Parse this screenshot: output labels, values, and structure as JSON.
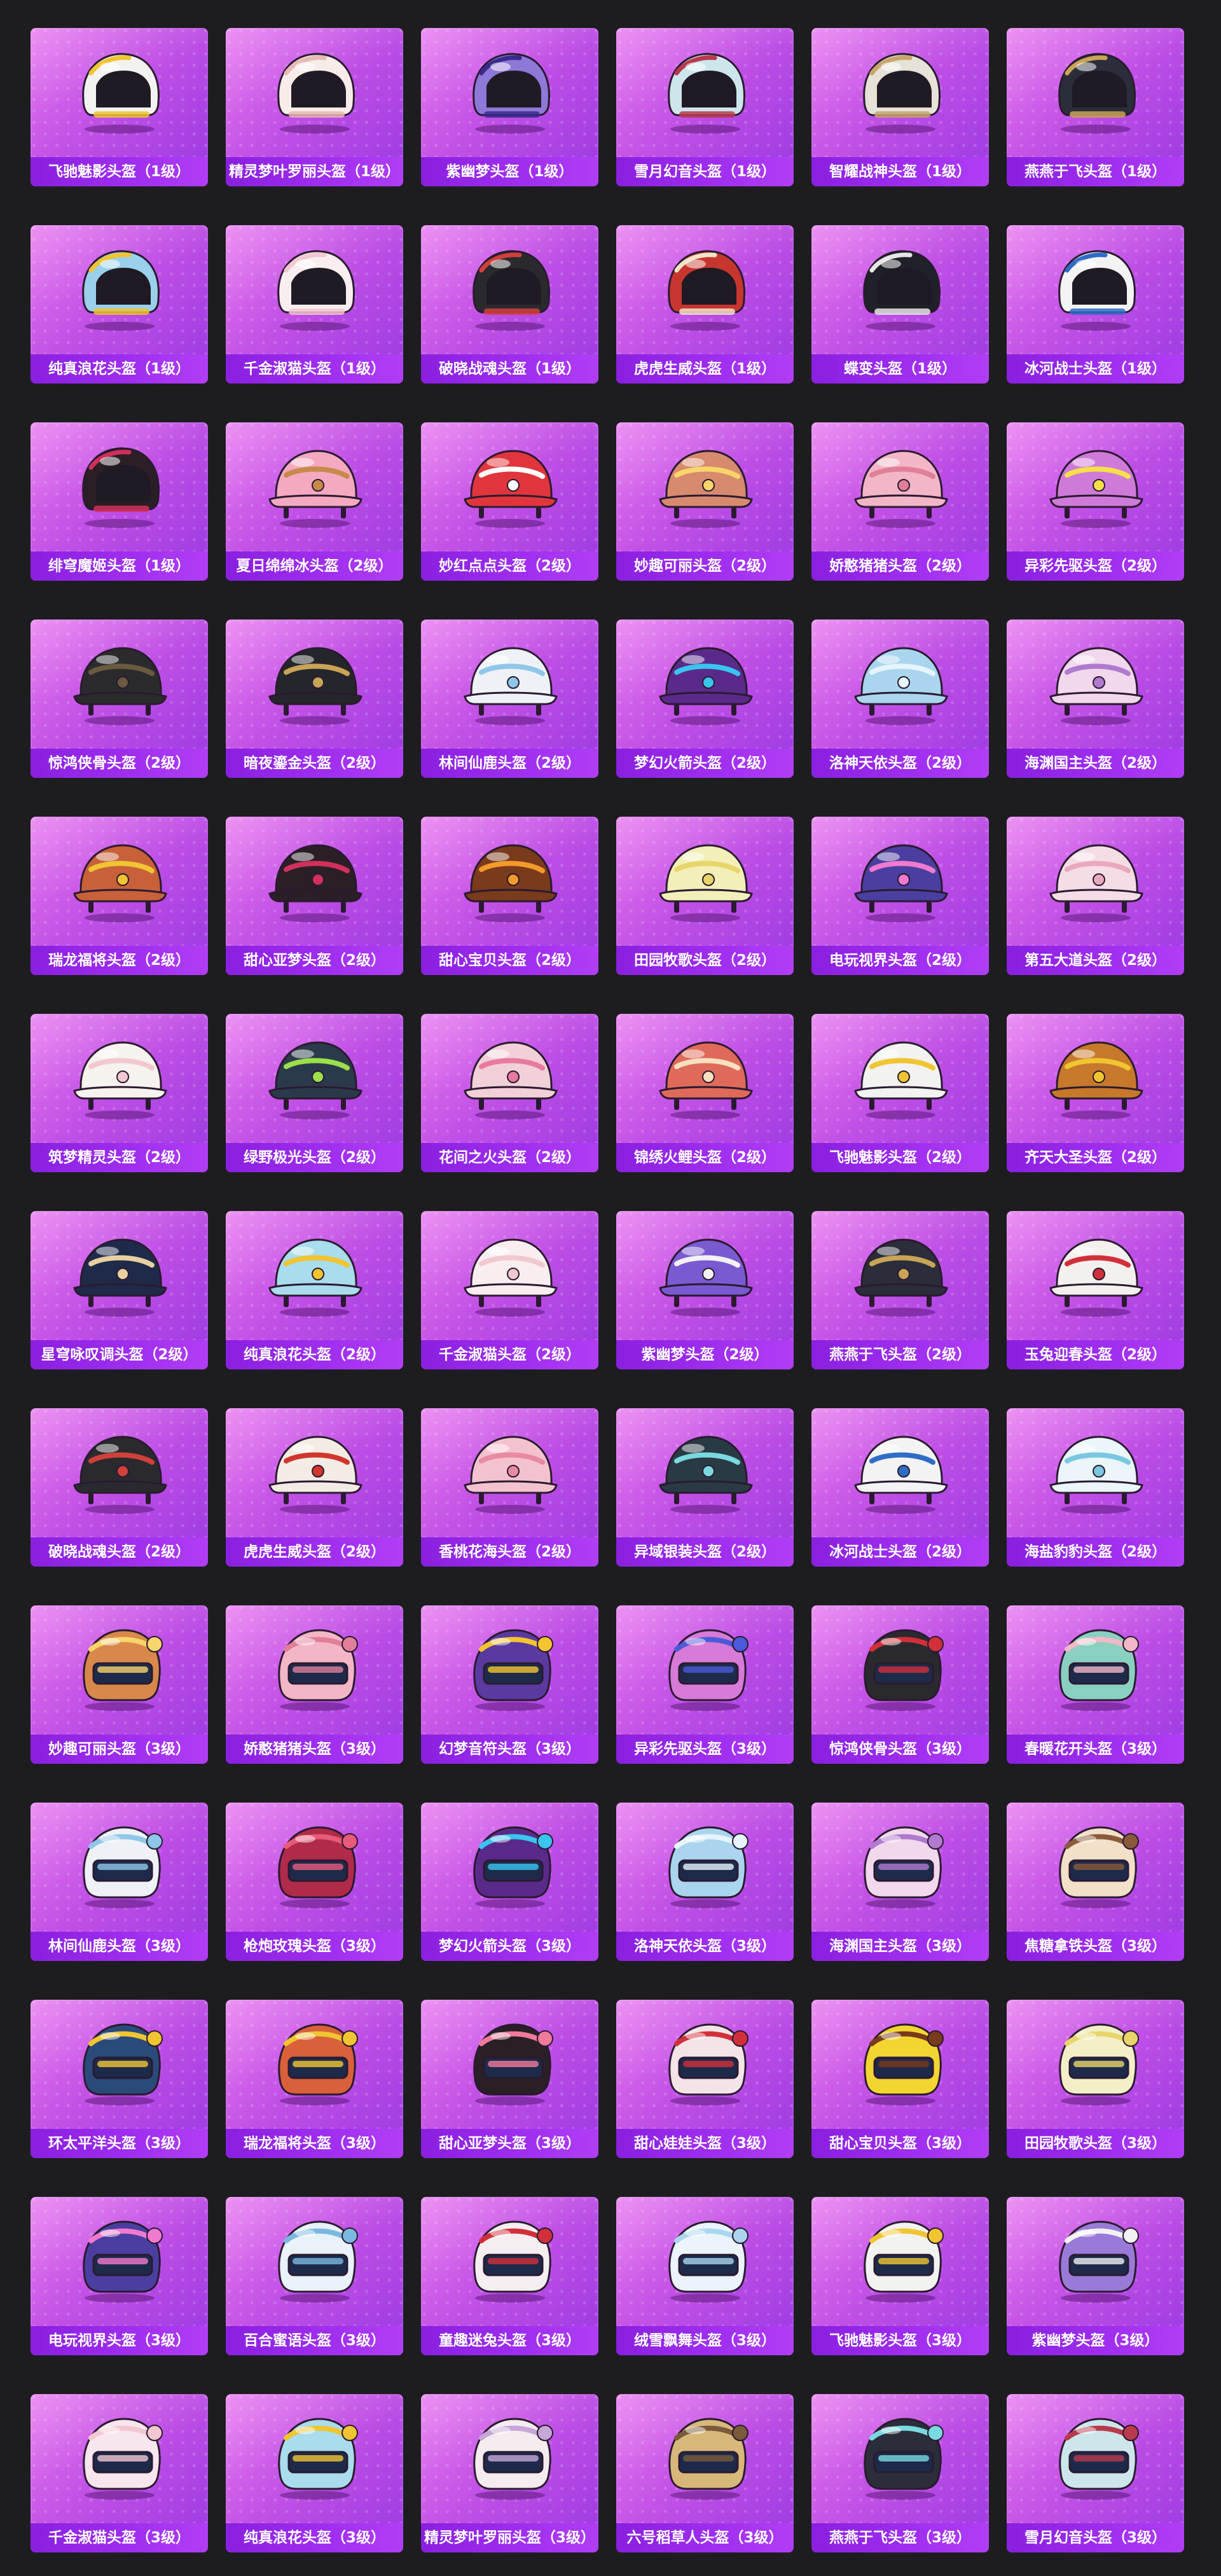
{
  "helmets": [
    {
      "name": "飞驰魅影头盔（1级）",
      "color": "#f2f2f0",
      "accent": "#f0c531",
      "level": 1
    },
    {
      "name": "精灵梦叶罗丽头盔（1级）",
      "color": "#f7ece8",
      "accent": "#e8b9b5",
      "level": 1
    },
    {
      "name": "紫幽梦头盔（1级）",
      "color": "#8e78d8",
      "accent": "#3a2a8c",
      "level": 1
    },
    {
      "name": "雪月幻音头盔（1级）",
      "color": "#cde6ec",
      "accent": "#b93a4d",
      "level": 1
    },
    {
      "name": "智耀战神头盔（1级）",
      "color": "#e6e2d8",
      "accent": "#c7a66b",
      "level": 1
    },
    {
      "name": "燕燕于飞头盔（1级）",
      "color": "#2b2d3a",
      "accent": "#c9a456",
      "level": 1
    },
    {
      "name": "纯真浪花头盔（1级）",
      "color": "#9ad0ec",
      "accent": "#f0c531",
      "level": 1
    },
    {
      "name": "千金淑猫头盔（1级）",
      "color": "#f8eef0",
      "accent": "#f2c8d0",
      "level": 1
    },
    {
      "name": "破晓战魂头盔（1级）",
      "color": "#2a2a2e",
      "accent": "#d2403a",
      "level": 1
    },
    {
      "name": "虎虎生威头盔（1级）",
      "color": "#c7362e",
      "accent": "#f4e3c8",
      "level": 1
    },
    {
      "name": "蝶变头盔（1级）",
      "color": "#1f2028",
      "accent": "#e6e6e6",
      "level": 1
    },
    {
      "name": "冰河战士头盔（1级）",
      "color": "#f3f3f4",
      "accent": "#2e6cc7",
      "level": 1
    },
    {
      "name": "绯穹魔姬头盔（1级）",
      "color": "#2a1f26",
      "accent": "#d1305c",
      "level": 1
    },
    {
      "name": "夏日绵绵冰头盔（2级）",
      "color": "#f4a9c0",
      "accent": "#c78a4a",
      "level": 2
    },
    {
      "name": "妙红点点头盔（2级）",
      "color": "#e0353c",
      "accent": "#ffffff",
      "level": 2
    },
    {
      "name": "妙趣可丽头盔（2级）",
      "color": "#d88a6e",
      "accent": "#f7d56a",
      "level": 2
    },
    {
      "name": "娇憨猪猪头盔（2级）",
      "color": "#f3b6c6",
      "accent": "#e07f9a",
      "level": 2
    },
    {
      "name": "异彩先驱头盔（2级）",
      "color": "#cf7ad8",
      "accent": "#f5e04a",
      "level": 2
    },
    {
      "name": "惊鸿侠骨头盔（2级）",
      "color": "#2b2b2e",
      "accent": "#6b5a40",
      "level": 2
    },
    {
      "name": "暗夜鎏金头盔（2级）",
      "color": "#25262b",
      "accent": "#c9a456",
      "level": 2
    },
    {
      "name": "林间仙鹿头盔（2级）",
      "color": "#eef2f6",
      "accent": "#8fc7e8",
      "level": 2
    },
    {
      "name": "梦幻火箭头盔（2级）",
      "color": "#5a2a8a",
      "accent": "#39c5f0",
      "level": 2
    },
    {
      "name": "洛神天依头盔（2级）",
      "color": "#a9d6ee",
      "accent": "#e6f4fb",
      "level": 2
    },
    {
      "name": "海渊国主头盔（2级）",
      "color": "#f1d8ec",
      "accent": "#b07ad0",
      "level": 2
    },
    {
      "name": "瑞龙福将头盔（2级）",
      "color": "#c8603a",
      "accent": "#f0c531",
      "level": 2
    },
    {
      "name": "甜心亚梦头盔（2级）",
      "color": "#2a1f26",
      "accent": "#d1305c",
      "level": 2
    },
    {
      "name": "甜心宝贝头盔（2级）",
      "color": "#7a3a1c",
      "accent": "#f39a2a",
      "level": 2
    },
    {
      "name": "田园牧歌头盔（2级）",
      "color": "#f2efb8",
      "accent": "#e8d56a",
      "level": 2
    },
    {
      "name": "电玩视界头盔（2级）",
      "color": "#4a3fa0",
      "accent": "#f07ad0",
      "level": 2
    },
    {
      "name": "第五大道头盔（2级）",
      "color": "#f5dde6",
      "accent": "#e8a9bd",
      "level": 2
    },
    {
      "name": "筑梦精灵头盔（2级）",
      "color": "#f6f2ee",
      "accent": "#f2c8d0",
      "level": 2
    },
    {
      "name": "绿野极光头盔（2级）",
      "color": "#2b3a4a",
      "accent": "#9be04a",
      "level": 2
    },
    {
      "name": "花间之火头盔（2级）",
      "color": "#f2d0d8",
      "accent": "#e87aa0",
      "level": 2
    },
    {
      "name": "锦绣火鲤头盔（2级）",
      "color": "#e06a5a",
      "accent": "#f7e0c0",
      "level": 2
    },
    {
      "name": "飞驰魅影头盔（2级）",
      "color": "#f2f2f0",
      "accent": "#f0c531",
      "level": 2
    },
    {
      "name": "齐天大圣头盔（2级）",
      "color": "#c7782a",
      "accent": "#f0c531",
      "level": 2
    },
    {
      "name": "星穹咏叹调头盔（2级）",
      "color": "#1f2a4a",
      "accent": "#e8d0a0",
      "level": 2
    },
    {
      "name": "纯真浪花头盔（2级）",
      "color": "#a9dcec",
      "accent": "#f0c531",
      "level": 2
    },
    {
      "name": "千金淑猫头盔（2级）",
      "color": "#f8eef0",
      "accent": "#f2c8d0",
      "level": 2
    },
    {
      "name": "紫幽梦头盔（2级）",
      "color": "#7a5ad0",
      "accent": "#f2f2f2",
      "level": 2
    },
    {
      "name": "燕燕于飞头盔（2级）",
      "color": "#2b2d3a",
      "accent": "#c9a456",
      "level": 2
    },
    {
      "name": "玉兔迎春头盔（2级）",
      "color": "#f4f0ee",
      "accent": "#d1303a",
      "level": 2
    },
    {
      "name": "破晓战魂头盔（2级）",
      "color": "#2a2a2e",
      "accent": "#d2403a",
      "level": 2
    },
    {
      "name": "虎虎生威头盔（2级）",
      "color": "#f2ece4",
      "accent": "#d1362e",
      "level": 2
    },
    {
      "name": "香桃花海头盔（2级）",
      "color": "#f4c2cf",
      "accent": "#e88aa2",
      "level": 2
    },
    {
      "name": "异域银装头盔（2级）",
      "color": "#2a3a44",
      "accent": "#7ad8e0",
      "level": 2
    },
    {
      "name": "冰河战士头盔（2级）",
      "color": "#f3f3f4",
      "accent": "#2e6cc7",
      "level": 2
    },
    {
      "name": "海盐豹豹头盔（2级）",
      "color": "#eaf6fa",
      "accent": "#7ac7e0",
      "level": 2
    },
    {
      "name": "妙趣可丽头盔（3级）",
      "color": "#d8884a",
      "accent": "#f7d56a",
      "level": 3
    },
    {
      "name": "娇憨猪猪头盔（3级）",
      "color": "#f3b6c6",
      "accent": "#e07f9a",
      "level": 3
    },
    {
      "name": "幻梦音符头盔（3级）",
      "color": "#5a3aa0",
      "accent": "#f5c531",
      "level": 3
    },
    {
      "name": "异彩先驱头盔（3级）",
      "color": "#d87ad8",
      "accent": "#4a5ad8",
      "level": 3
    },
    {
      "name": "惊鸿侠骨头盔（3级）",
      "color": "#2a2a2e",
      "accent": "#d1303a",
      "level": 3
    },
    {
      "name": "春暖花开头盔（3级）",
      "color": "#8ad0c0",
      "accent": "#f2b8c8",
      "level": 3
    },
    {
      "name": "林间仙鹿头盔（3级）",
      "color": "#eef2f6",
      "accent": "#8fc7e8",
      "level": 3
    },
    {
      "name": "枪炮玫瑰头盔（3级）",
      "color": "#b02a4a",
      "accent": "#e85a7a",
      "level": 3
    },
    {
      "name": "梦幻火箭头盔（3级）",
      "color": "#5a2a8a",
      "accent": "#39c5f0",
      "level": 3
    },
    {
      "name": "洛神天依头盔（3级）",
      "color": "#a9d6ee",
      "accent": "#e6f4fb",
      "level": 3
    },
    {
      "name": "海渊国主头盔（3级）",
      "color": "#f1d8ec",
      "accent": "#b07ad0",
      "level": 3
    },
    {
      "name": "焦糖拿铁头盔（3级）",
      "color": "#f2e0c8",
      "accent": "#8a5a3a",
      "level": 3
    },
    {
      "name": "环太平洋头盔（3级）",
      "color": "#2a4a7a",
      "accent": "#f0c531",
      "level": 3
    },
    {
      "name": "瑞龙福将头盔（3级）",
      "color": "#d8603a",
      "accent": "#f0c531",
      "level": 3
    },
    {
      "name": "甜心亚梦头盔（3级）",
      "color": "#2a1f26",
      "accent": "#f07a9a",
      "level": 3
    },
    {
      "name": "甜心娃娃头盔（3级）",
      "color": "#f4e4e8",
      "accent": "#d1303a",
      "level": 3
    },
    {
      "name": "甜心宝贝头盔（3级）",
      "color": "#f3d531",
      "accent": "#7a3a1c",
      "level": 3
    },
    {
      "name": "田园牧歌头盔（3级）",
      "color": "#f2efc8",
      "accent": "#e8d56a",
      "level": 3
    },
    {
      "name": "电玩视界头盔（3级）",
      "color": "#4a3fa0",
      "accent": "#f07ad0",
      "level": 3
    },
    {
      "name": "百合蜜语头盔（3级）",
      "color": "#e8f2f8",
      "accent": "#7ab8e0",
      "level": 3
    },
    {
      "name": "童趣迷兔头盔（3级）",
      "color": "#f4eef0",
      "accent": "#d1303a",
      "level": 3
    },
    {
      "name": "绒雪飘舞头盔（3级）",
      "color": "#eaf4fa",
      "accent": "#a9d6ee",
      "level": 3
    },
    {
      "name": "飞驰魅影头盔（3级）",
      "color": "#f2f2f0",
      "accent": "#f0c531",
      "level": 3
    },
    {
      "name": "紫幽梦头盔（3级）",
      "color": "#9a7ad8",
      "accent": "#f2f2f2",
      "level": 3
    },
    {
      "name": "千金淑猫头盔（3级）",
      "color": "#f8e6ee",
      "accent": "#f2c8d0",
      "level": 3
    },
    {
      "name": "纯真浪花头盔（3级）",
      "color": "#a9dcec",
      "accent": "#f0c531",
      "level": 3
    },
    {
      "name": "精灵梦叶罗丽头盔（3级）",
      "color": "#f4ecee",
      "accent": "#c7a6d8",
      "level": 3
    },
    {
      "name": "六号稻草人头盔（3级）",
      "color": "#d8b87a",
      "accent": "#7a5a3a",
      "level": 3
    },
    {
      "name": "燕燕于飞头盔（3级）",
      "color": "#2b2d3a",
      "accent": "#7ad8e0",
      "level": 3
    },
    {
      "name": "雪月幻音头盔（3级）",
      "color": "#cde6ec",
      "accent": "#b93a4d",
      "level": 3
    }
  ]
}
